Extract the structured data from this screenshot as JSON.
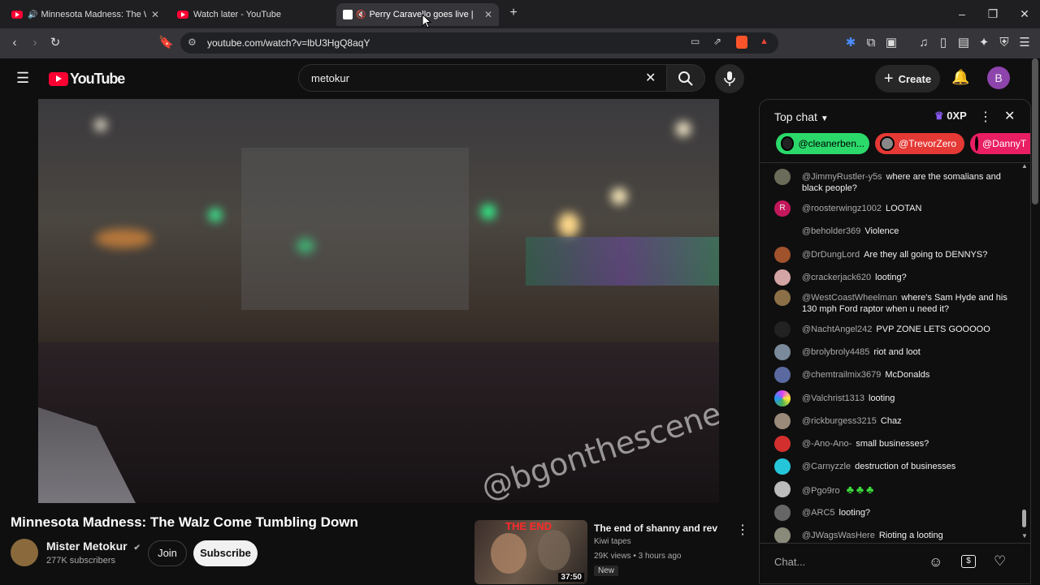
{
  "browser": {
    "tabs": [
      {
        "title": "Minnesota Madness: The Wal",
        "active": false
      },
      {
        "title": "Watch later - YouTube",
        "active": false
      },
      {
        "title": "Perry Caravello goes live | Pat",
        "active": true
      }
    ],
    "url": "youtube.com/watch?v=lbU3HgQ8aqY"
  },
  "youtube": {
    "logo_text": "YouTube",
    "search_value": "metokur",
    "create_label": "Create",
    "avatar_letter": "B"
  },
  "video": {
    "watermark": "@bgonthescene",
    "title": "Minnesota Madness: The Walz Come Tumbling Down",
    "channel": "Mister Metokur",
    "subscribers": "277K subscribers",
    "join_label": "Join",
    "subscribe_label": "Subscribe"
  },
  "recommendation": {
    "thumb_text": "THE END",
    "duration": "37:50",
    "title": "The end of shanny and rev",
    "channel": "Kiwi tapes",
    "meta": "29K views • 3 hours ago",
    "badge": "New"
  },
  "chat": {
    "header": "Top chat",
    "xp": "0XP",
    "chips": [
      "@cleanerben...",
      "@TrevorZero",
      "@DannyT"
    ],
    "messages": [
      {
        "author": "@JimmyRustler-y5s",
        "text": "where are the somalians and black people?",
        "color": "#6b6b5a"
      },
      {
        "author": "@roosterwingz1002",
        "text": "LOOTAN",
        "color": "#c2185b"
      },
      {
        "author": "@beholder369",
        "text": "Violence",
        "color": "#0f0f0f"
      },
      {
        "author": "@DrDungLord",
        "text": "Are they all going to DENNYS?",
        "color": "#a0522d"
      },
      {
        "author": "@crackerjack620",
        "text": "looting?",
        "color": "#d4a5a5"
      },
      {
        "author": "@WestCoastWheelman",
        "text": "where's Sam Hyde and his 130 mph Ford raptor when u need it?",
        "color": "#8b6f47"
      },
      {
        "author": "@NachtAngel242",
        "text": "PVP ZONE LETS GOOOOO",
        "color": "#222222"
      },
      {
        "author": "@brolybroly4485",
        "text": "riot and loot",
        "color": "#7a8a9a"
      },
      {
        "author": "@chemtrailmix3679",
        "text": "McDonalds",
        "color": "#5a6aa0"
      },
      {
        "author": "@Valchrist1313",
        "text": "looting",
        "color": "#e040fb"
      },
      {
        "author": "@rickburgess3215",
        "text": "Chaz",
        "color": "#9a8a7a"
      },
      {
        "author": "@-Ano-Ano-",
        "text": "small businesses?",
        "color": "#d32f2f"
      },
      {
        "author": "@Carnyzzle",
        "text": "destruction of businesses",
        "color": "#26c6da"
      },
      {
        "author": "@Pgo9ro",
        "text": "",
        "color": "#bbbbbb"
      },
      {
        "author": "@ARC5",
        "text": "looting?",
        "color": "#666666"
      },
      {
        "author": "@JWagsWasHere",
        "text": "Rioting a looting",
        "color": "#8a8a7a"
      }
    ],
    "input_placeholder": "Chat..."
  }
}
